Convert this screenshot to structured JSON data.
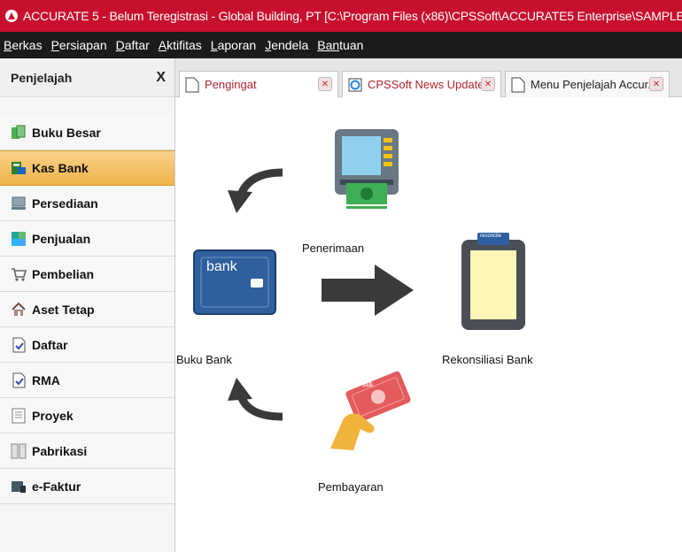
{
  "window": {
    "title": "ACCURATE 5  - Belum Teregistrasi - Global Building, PT  [C:\\Program Files (x86)\\CPSSoft\\ACCURATE5 Enterprise\\SAMPLE\\SAMPL"
  },
  "menu": [
    {
      "mnemonic": "B",
      "rest": "erkas"
    },
    {
      "mnemonic": "P",
      "rest": "ersiapan"
    },
    {
      "mnemonic": "D",
      "rest": "aftar"
    },
    {
      "mnemonic": "A",
      "rest": "ktifitas"
    },
    {
      "mnemonic": "L",
      "rest": "aporan"
    },
    {
      "mnemonic": "J",
      "rest": "endela"
    },
    {
      "mnemonic": "Ban",
      "rest": "tuan"
    }
  ],
  "sidebar": {
    "title": "Penjelajah",
    "close": "X",
    "items": [
      {
        "label": "Buku Besar",
        "icon": "ledger-icon",
        "color": "#4caf50"
      },
      {
        "label": "Kas Bank",
        "icon": "cash-bank-icon",
        "color": "#2e7d32",
        "active": true
      },
      {
        "label": "Persediaan",
        "icon": "inventory-icon",
        "color": "#6d7b8d"
      },
      {
        "label": "Penjualan",
        "icon": "sales-icon",
        "color": "#26a69a"
      },
      {
        "label": "Pembelian",
        "icon": "cart-icon",
        "color": "#777777"
      },
      {
        "label": "Aset Tetap",
        "icon": "house-icon",
        "color": "#8d6e63"
      },
      {
        "label": "Daftar",
        "icon": "list-icon",
        "color": "#5c6bc0"
      },
      {
        "label": "RMA",
        "icon": "rma-icon",
        "color": "#5c6bc0"
      },
      {
        "label": "Proyek",
        "icon": "project-icon",
        "color": "#9e9e9e"
      },
      {
        "label": "Pabrikasi",
        "icon": "factory-icon",
        "color": "#9e9e9e"
      },
      {
        "label": "e-Faktur",
        "icon": "efaktur-icon",
        "color": "#455a64"
      }
    ]
  },
  "tabs": [
    {
      "label": "Pengingat"
    },
    {
      "label": "CPSSoft News Update"
    },
    {
      "label": "Menu Penjelajah Accur..."
    }
  ],
  "flow": {
    "penerimaan": "Penerimaan",
    "buku_bank": "Buku Bank",
    "rekonsiliasi": "Rekonsiliasi Bank",
    "pembayaran": "Pembayaran",
    "bank_card_text": "bank",
    "reconcile_tag": "reconcile",
    "money_text": "$$$"
  },
  "colors": {
    "titlebar": "#c8102e",
    "menubar": "#1b1b1b",
    "active_item": "#f0b449",
    "bank_card": "#2f5f9e",
    "arrow": "#3a3a3a"
  }
}
